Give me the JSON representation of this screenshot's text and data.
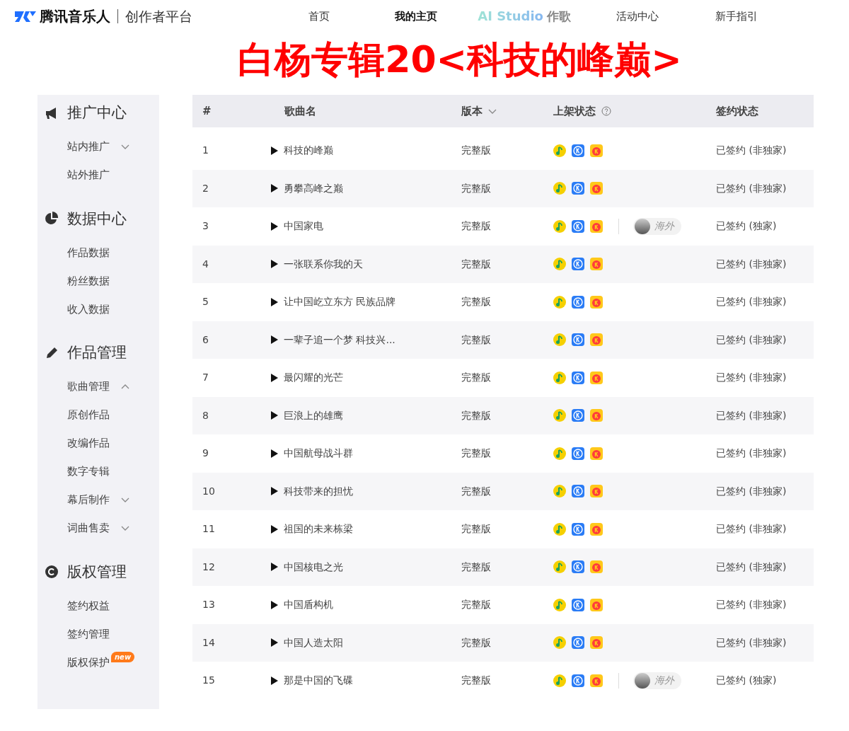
{
  "brand": {
    "name": "腾讯音乐人",
    "subtitle": "创作者平台"
  },
  "nav": [
    {
      "label": "首页",
      "kind": "plain",
      "selected": false
    },
    {
      "label": "我的主页",
      "kind": "plain",
      "selected": true
    },
    {
      "label": "AI Studio",
      "suffix": "作歌",
      "kind": "ai",
      "selected": false
    },
    {
      "label": "活动中心",
      "kind": "plain",
      "selected": false
    },
    {
      "label": "新手指引",
      "kind": "plain",
      "selected": false
    }
  ],
  "banner": "白杨专辑20<科技的峰巅>",
  "sidebar": [
    {
      "title": "推广中心",
      "items": [
        {
          "label": "站内推广",
          "expanded": false
        },
        {
          "label": "站外推广"
        }
      ]
    },
    {
      "title": "数据中心",
      "items": [
        {
          "label": "作品数据"
        },
        {
          "label": "粉丝数据"
        },
        {
          "label": "收入数据"
        }
      ]
    },
    {
      "title": "作品管理",
      "items": [
        {
          "label": "歌曲管理",
          "expanded": true
        },
        {
          "label": "原创作品"
        },
        {
          "label": "改编作品"
        },
        {
          "label": "数字专辑"
        },
        {
          "label": "幕后制作",
          "expanded": false
        },
        {
          "label": "词曲售卖",
          "expanded": false
        }
      ]
    },
    {
      "title": "版权管理",
      "items": [
        {
          "label": "签约权益"
        },
        {
          "label": "签约管理"
        },
        {
          "label": "版权保护",
          "badge": "new"
        }
      ]
    }
  ],
  "table": {
    "columns": [
      "#",
      "歌曲名",
      "版本",
      "上架状态",
      "签约状态"
    ],
    "rows": [
      {
        "no": "1",
        "title": "科技的峰巅",
        "version": "完整版",
        "overseas": null,
        "contract": "已签约 (非独家)"
      },
      {
        "no": "2",
        "title": "勇攀高峰之巅",
        "version": "完整版",
        "overseas": null,
        "contract": "已签约 (非独家)"
      },
      {
        "no": "3",
        "title": "中国家电",
        "version": "完整版",
        "overseas": "海外",
        "contract": "已签约 (独家)"
      },
      {
        "no": "4",
        "title": "一张联系你我的天",
        "version": "完整版",
        "overseas": null,
        "contract": "已签约 (非独家)"
      },
      {
        "no": "5",
        "title": "让中国屹立东方 民族品牌",
        "version": "完整版",
        "overseas": null,
        "contract": "已签约 (非独家)"
      },
      {
        "no": "6",
        "title": "一辈子追一个梦 科技兴...",
        "version": "完整版",
        "overseas": null,
        "contract": "已签约 (非独家)"
      },
      {
        "no": "7",
        "title": "最闪耀的光芒",
        "version": "完整版",
        "overseas": null,
        "contract": "已签约 (非独家)"
      },
      {
        "no": "8",
        "title": "巨浪上的雄鹰",
        "version": "完整版",
        "overseas": null,
        "contract": "已签约 (非独家)"
      },
      {
        "no": "9",
        "title": "中国航母战斗群",
        "version": "完整版",
        "overseas": null,
        "contract": "已签约 (非独家)"
      },
      {
        "no": "10",
        "title": "科技带来的担忧",
        "version": "完整版",
        "overseas": null,
        "contract": "已签约 (非独家)"
      },
      {
        "no": "11",
        "title": "祖国的未来栋梁",
        "version": "完整版",
        "overseas": null,
        "contract": "已签约 (非独家)"
      },
      {
        "no": "12",
        "title": "中国核电之光",
        "version": "完整版",
        "overseas": null,
        "contract": "已签约 (非独家)"
      },
      {
        "no": "13",
        "title": "中国盾构机",
        "version": "完整版",
        "overseas": null,
        "contract": "已签约 (非独家)"
      },
      {
        "no": "14",
        "title": "中国人造太阳",
        "version": "完整版",
        "overseas": null,
        "contract": "已签约 (非独家)"
      },
      {
        "no": "15",
        "title": "那是中国的飞碟",
        "version": "完整版",
        "overseas": "海外",
        "contract": "已签约 (独家)"
      }
    ]
  }
}
